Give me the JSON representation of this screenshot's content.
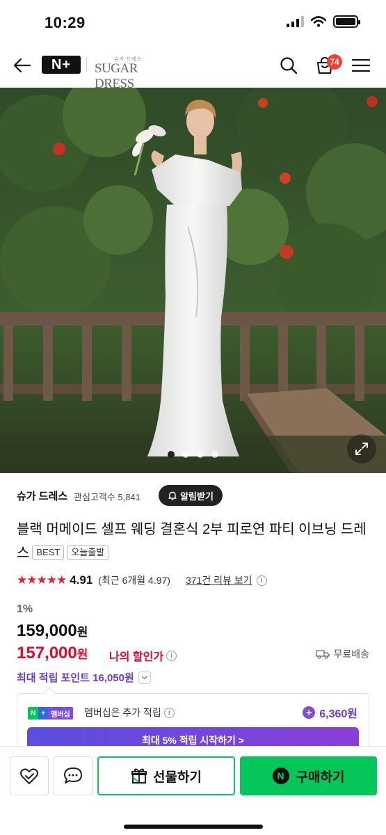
{
  "status_bar": {
    "time": "10:29"
  },
  "header": {
    "logo": "N+",
    "brand_small": "슈가 드레스",
    "brand": "SUGAR DRESS",
    "cart_count": "74"
  },
  "hero": {
    "slide_count": 4,
    "active_slide": 1
  },
  "store": {
    "name": "슈가 드레스",
    "followers": "관심고객수 5,841",
    "alarm_label": "알림받기"
  },
  "product": {
    "title": "블랙 머메이드 셀프 웨딩 결혼식 2부 피로연 파티 이브닝 드레스",
    "tags": [
      "BEST",
      "오늘출발"
    ],
    "stars": "★★★★★",
    "rating": "4.91",
    "recent_rating": "(최근 6개월 4.97)",
    "review_link": "371건 리뷰 보기",
    "discount_rate": "1%",
    "original_price": "159,000",
    "sale_price": "157,000",
    "currency": "원",
    "my_discount_label": "나의 할인가",
    "shipping": "무료배송",
    "max_points": "최대 적립 포인트 16,050원"
  },
  "membership": {
    "logo_n": "N",
    "logo_plus": "+",
    "logo_label": "멤버십",
    "text": "멤버십은 추가 적립",
    "points": "6,360원",
    "cta": "최대 5% 적립 시작하기 >"
  },
  "bottom_bar": {
    "gift_label": "선물하기",
    "buy_label": "구매하기",
    "npay": "N"
  },
  "colors": {
    "accent_red": "#e0082b",
    "naver_green": "#03c75a",
    "purple": "#6b3fc9",
    "badge": "#ef4136"
  }
}
